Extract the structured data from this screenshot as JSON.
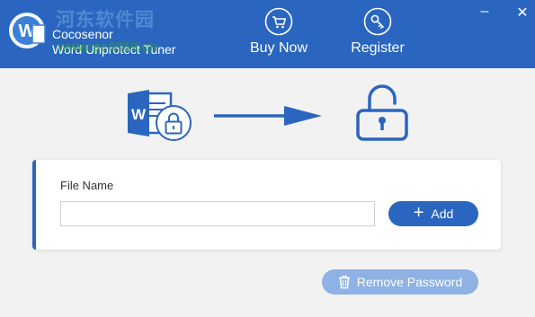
{
  "header": {
    "app_line1": "Cocosenor",
    "app_line2": "Word Unprotect Tuner",
    "watermark_text": "河东软件园",
    "watermark_url": "www.pc0359.cn",
    "buy_now_label": "Buy Now",
    "register_label": "Register",
    "buy_icon": "cart-icon",
    "register_icon": "key-icon",
    "minimize_glyph": "–",
    "close_glyph": "✕"
  },
  "illustration": {
    "word_badge": "W",
    "word_icon": "word-document-locked-icon",
    "arrow_icon": "right-arrow-icon",
    "unlock_icon": "unlocked-padlock-icon"
  },
  "file_card": {
    "file_label": "File Name",
    "file_value": "",
    "file_placeholder": "",
    "add_label": "Add",
    "add_icon": "plus-icon"
  },
  "actions": {
    "remove_label": "Remove Password",
    "remove_icon": "trash-icon"
  },
  "colors": {
    "header_bg": "#2a66bf",
    "accent": "#2a66bf",
    "remove_button_bg": "#8db2e3",
    "page_bg": "#f2f2f2"
  }
}
